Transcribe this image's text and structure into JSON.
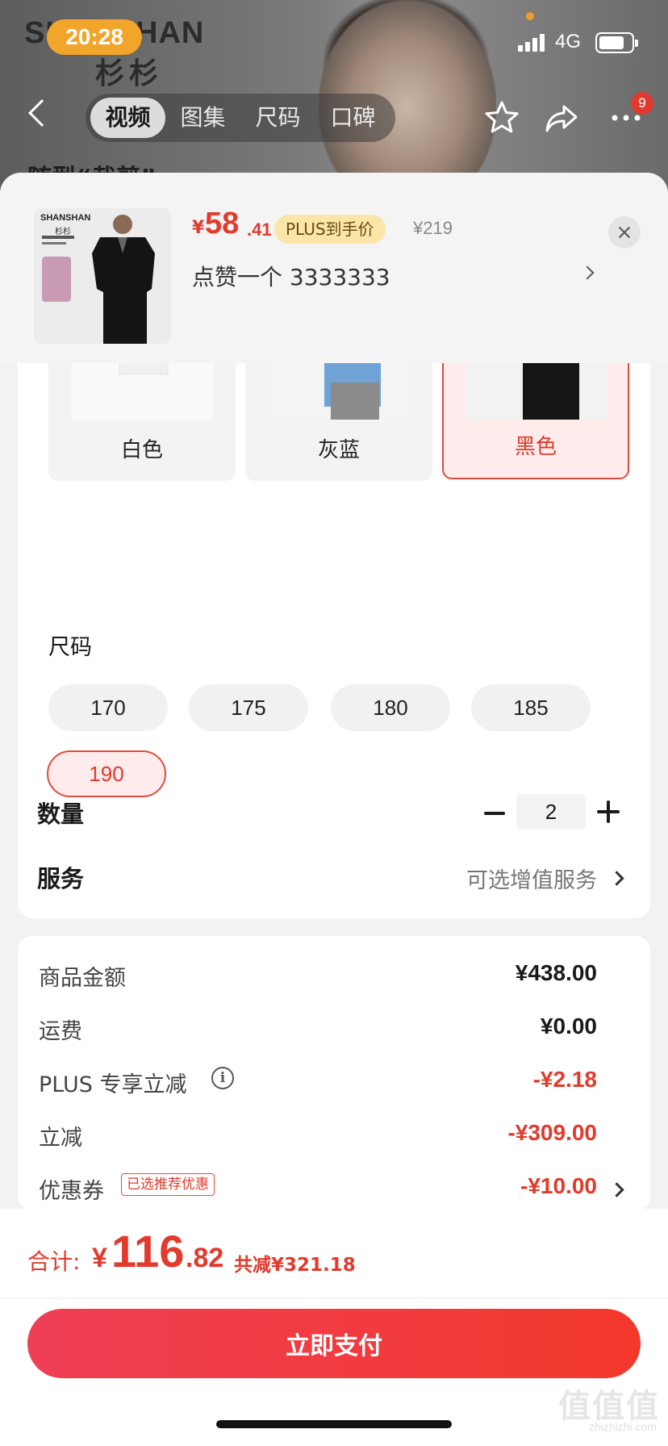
{
  "status_bar": {
    "time": "20:28",
    "network": "4G"
  },
  "background": {
    "brand_en": "SHANSHAN",
    "brand_cn": "杉杉",
    "title": "随型“裁剪”"
  },
  "nav": {
    "tabs": [
      {
        "label": "视频",
        "active": true
      },
      {
        "label": "图集"
      },
      {
        "label": "尺码"
      },
      {
        "label": "口碑"
      }
    ],
    "badge_count": "9"
  },
  "product": {
    "thumb_brand": "SHANSHAN",
    "thumb_brand_cn": "杉杉",
    "price_symbol": "¥",
    "price_int": "58",
    "price_dec": ".41",
    "plus_tag": "PLUS到手价",
    "original_price": "¥219",
    "liked_text": "点赞一个  3333333"
  },
  "colors": {
    "options": [
      {
        "label": "白色"
      },
      {
        "label": "灰蓝"
      },
      {
        "label": "黑色",
        "selected": true
      }
    ]
  },
  "size": {
    "label": "尺码",
    "options": [
      {
        "label": "170"
      },
      {
        "label": "175"
      },
      {
        "label": "180"
      },
      {
        "label": "185"
      },
      {
        "label": "190",
        "selected": true
      }
    ]
  },
  "quantity": {
    "label": "数量",
    "value": "2"
  },
  "service": {
    "label": "服务",
    "value": "可选增值服务"
  },
  "bill": {
    "rows": [
      {
        "label": "商品金额",
        "value": "¥438.00"
      },
      {
        "label": "运费",
        "value": "¥0.00"
      },
      {
        "label": "PLUS 专享立减",
        "value": "-¥2.18"
      },
      {
        "label": "立减",
        "value": "-¥309.00"
      },
      {
        "label": "优惠券",
        "value": "-¥10.00",
        "tag": "已选推荐优惠"
      }
    ]
  },
  "footer": {
    "total_label": "合计:",
    "total_symbol": "¥",
    "total_int": "116",
    "total_dec": ".82",
    "saved": "共减¥321.18",
    "pay_button": "立即支付"
  },
  "watermark": {
    "main": "值值值",
    "sub": "zhizhizhi.com"
  },
  "theme": {
    "accent": "#e23a2c",
    "pay_button": "#f3382c",
    "plus_tag_bg": "#fbe6a8"
  }
}
